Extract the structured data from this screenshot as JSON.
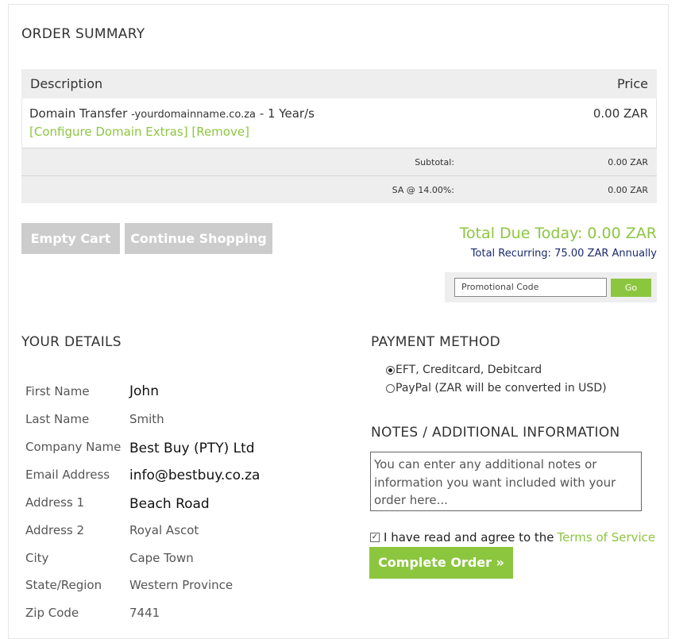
{
  "order_summary": {
    "title": "ORDER SUMMARY",
    "header": {
      "description": "Description",
      "price": "Price"
    },
    "item": {
      "name": "Domain Transfer",
      "domain": "-yourdomainname.co.za",
      "term": "- 1 Year/s",
      "configure_link": "[Configure Domain Extras]",
      "remove_link": "[Remove]",
      "price": "0.00 ZAR"
    },
    "subtotal": {
      "label": "Subtotal:",
      "value": "0.00 ZAR"
    },
    "tax": {
      "label": "SA @ 14.00%:",
      "value": "0.00 ZAR"
    }
  },
  "cart_actions": {
    "empty_cart": "Empty Cart",
    "continue_shopping": "Continue Shopping"
  },
  "totals": {
    "due_today": "Total Due Today: 0.00 ZAR",
    "recurring": "Total Recurring: 75.00 ZAR Annually"
  },
  "promo": {
    "placeholder": "Promotional Code",
    "go": "Go"
  },
  "your_details": {
    "title": "YOUR DETAILS",
    "fields": [
      {
        "label": "First Name",
        "value": "John"
      },
      {
        "label": "Last Name",
        "value": "Smith"
      },
      {
        "label": "Company Name",
        "value": "Best Buy (PTY) Ltd"
      },
      {
        "label": "Email Address",
        "value": "info@bestbuy.co.za"
      },
      {
        "label": "Address 1",
        "value": "Beach Road"
      },
      {
        "label": "Address 2",
        "value": "Royal Ascot"
      },
      {
        "label": "City",
        "value": "Cape Town"
      },
      {
        "label": "State/Region",
        "value": "Western Province"
      },
      {
        "label": "Zip Code",
        "value": "7441"
      }
    ]
  },
  "payment": {
    "title": "PAYMENT METHOD",
    "options": [
      {
        "label": "EFT, Creditcard, Debitcard",
        "selected": true
      },
      {
        "label": "PayPal (ZAR will be converted in USD)",
        "selected": false
      }
    ]
  },
  "notes": {
    "title": "NOTES / ADDITIONAL INFORMATION",
    "placeholder": "You can enter any additional notes or information you want included with your order here..."
  },
  "agree": {
    "text": "I have read and agree to the",
    "link": "Terms of Service",
    "checked": true
  },
  "complete_button": "Complete Order »",
  "colors": {
    "accent": "#8cc63f",
    "grey_button": "#cccccc",
    "recurring_text": "#1a2a6c"
  }
}
